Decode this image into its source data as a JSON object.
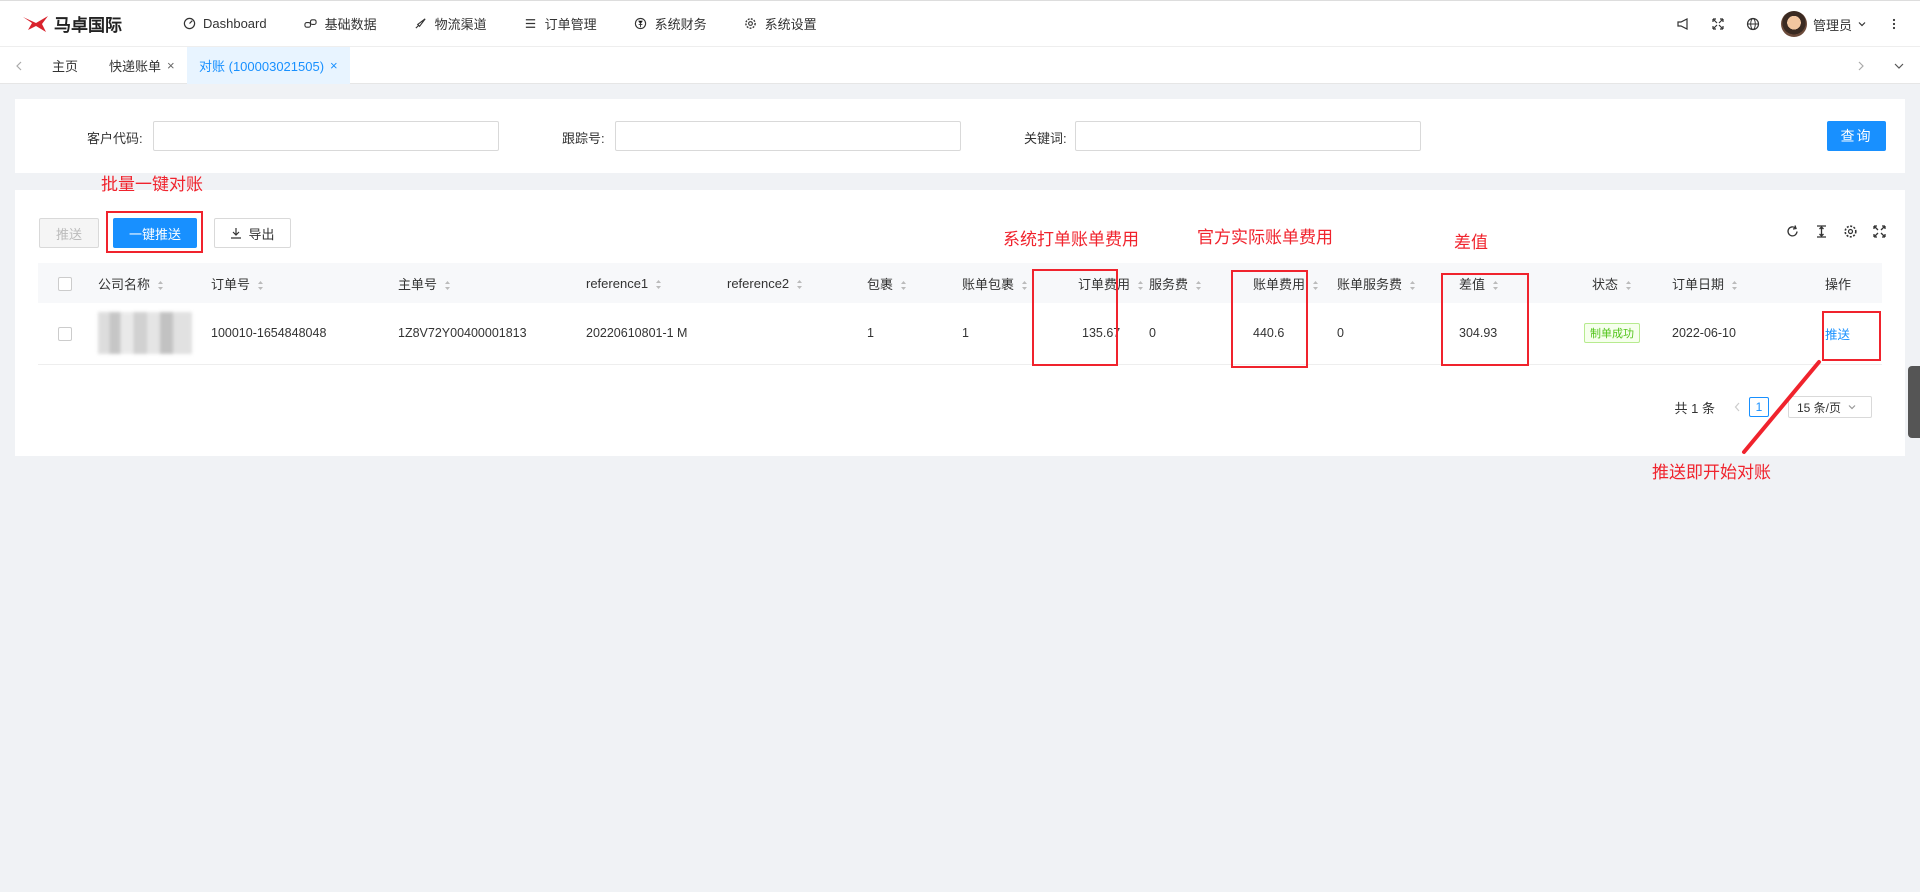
{
  "brand": {
    "name": "马卓国际"
  },
  "nav": [
    {
      "label": "Dashboard",
      "icon": "dashboard-icon"
    },
    {
      "label": "基础数据",
      "icon": "link-icon"
    },
    {
      "label": "物流渠道",
      "icon": "rocket-icon"
    },
    {
      "label": "订单管理",
      "icon": "list-icon"
    },
    {
      "label": "系统财务",
      "icon": "yen-icon"
    },
    {
      "label": "系统设置",
      "icon": "gear-icon"
    }
  ],
  "header": {
    "user_name": "管理员"
  },
  "tabs": [
    {
      "label": "主页",
      "closable": false,
      "active": false
    },
    {
      "label": "快递账单",
      "closable": true,
      "active": false
    },
    {
      "label": "对账 (100003021505)",
      "closable": true,
      "active": true
    }
  ],
  "search": {
    "customer_code_label": "客户代码:",
    "tracking_label": "跟踪号:",
    "keyword_label": "关键词:",
    "customer_code_value": "",
    "tracking_value": "",
    "keyword_value": "",
    "query_button": "查询"
  },
  "toolbar": {
    "push_label": "推送",
    "one_click_push_label": "一键推送",
    "export_label": "导出"
  },
  "table": {
    "columns": [
      "公司名称",
      "订单号",
      "主单号",
      "reference1",
      "reference2",
      "包裹",
      "账单包裹",
      "订单费用",
      "服务费",
      "账单费用",
      "账单服务费",
      "差值",
      "状态",
      "订单日期",
      "操作"
    ],
    "rows": [
      {
        "company": "",
        "order_no": "100010-1654848048",
        "master_no": "1Z8V72Y00400001813",
        "reference1": "20220610801-1 M",
        "reference2": "",
        "packages": "1",
        "bill_packages": "1",
        "order_fee": "135.67",
        "service_fee": "0",
        "bill_fee": "440.6",
        "bill_service_fee": "0",
        "diff": "304.93",
        "status": "制单成功",
        "order_date": "2022-06-10",
        "action": "推送"
      }
    ]
  },
  "pagination": {
    "total": "共 1 条",
    "current_page": "1",
    "page_size": "15 条/页"
  },
  "annotations": {
    "batch": "批量一键对账",
    "system_fee": "系统打单账单费用",
    "official_fee": "官方实际账单费用",
    "diff": "差值",
    "push_start": "推送即开始对账"
  },
  "colors": {
    "primary": "#1890ff",
    "annotation": "#f0232d",
    "success": "#52c41a"
  }
}
